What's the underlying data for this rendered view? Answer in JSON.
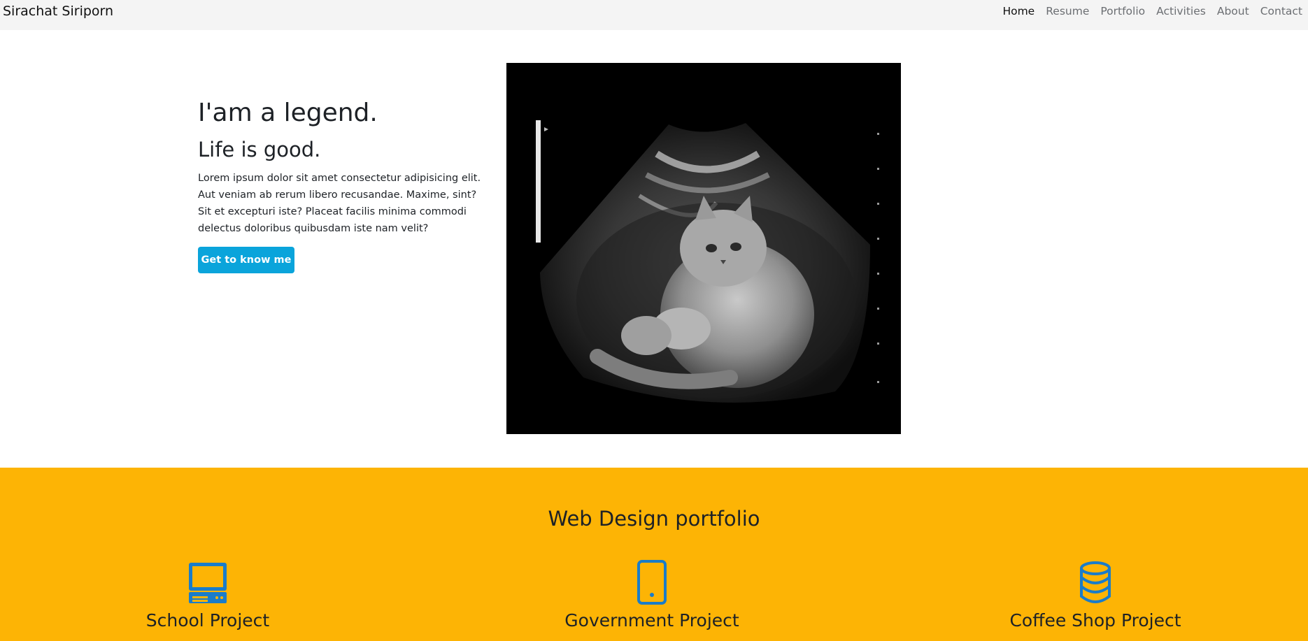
{
  "navbar": {
    "brand": "Sirachat Siriporn",
    "links": [
      "Home",
      "Resume",
      "Portfolio",
      "Activities",
      "About",
      "Contact"
    ],
    "active_link": "Home"
  },
  "hero": {
    "title": "I'am a legend.",
    "subtitle": "Life is good.",
    "text": "Lorem ipsum dolor sit amet consectetur adipisicing elit. Aut veniam ab rerum libero recusandae. Maxime, sint? Sit et excepturi iste? Placeat facilis minima commodi delectus doloribus quibusdam iste nam velit?",
    "button_label": "Get to know me",
    "image": "cat-ultrasound-image"
  },
  "portfolio": {
    "title": "Web Design portfolio",
    "projects": [
      {
        "name": "School Project",
        "icon": "desktop-computer-icon"
      },
      {
        "name": "Government Project",
        "icon": "mobile-phone-icon"
      },
      {
        "name": "Coffee Shop Project",
        "icon": "database-icon"
      }
    ]
  },
  "colors": {
    "navbar_bg": "#f4f4f4",
    "button_bg": "#0aa4db",
    "portfolio_bg": "#fdb405",
    "icon_color": "#1a7cc9"
  }
}
